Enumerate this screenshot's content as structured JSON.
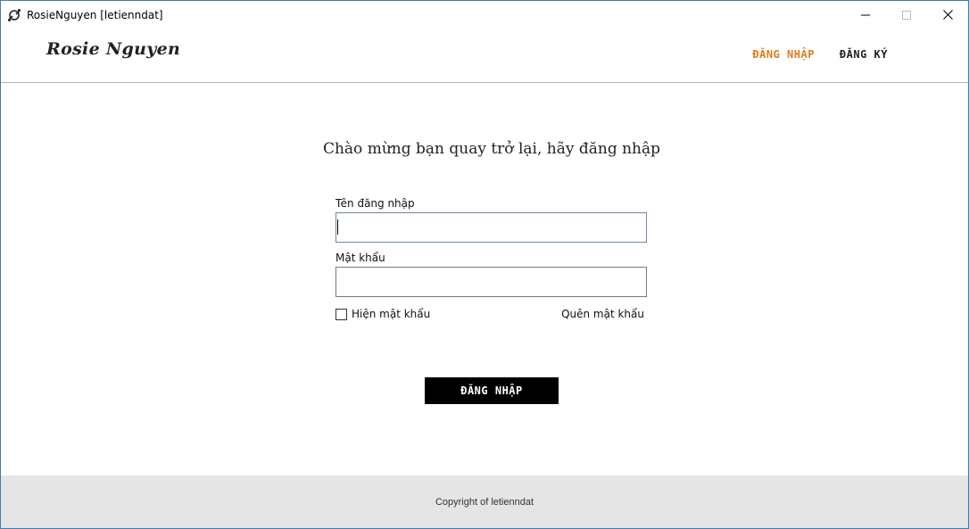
{
  "window": {
    "title": "RosieNguyen [letienndat]"
  },
  "header": {
    "brand": "Rosie Nguyen",
    "nav": {
      "login": "ĐĂNG NHẬP",
      "register": "ĐĂNG KÝ"
    },
    "active_color": "#e07b1a"
  },
  "main": {
    "welcome": "Chào mừng bạn quay trở lại, hãy đăng nhập",
    "username": {
      "label": "Tên đăng nhập",
      "value": ""
    },
    "password": {
      "label": "Mật khẩu",
      "value": ""
    },
    "show_password": {
      "label": "Hiện mật khẩu",
      "checked": false
    },
    "forgot_password": "Quên mật khẩu",
    "submit": "ĐĂNG NHẬP"
  },
  "footer": {
    "copyright": "Copyright of letienndat"
  },
  "icons": {
    "app": "app-logo-icon",
    "minimize": "minimize-icon",
    "maximize": "maximize-icon",
    "close": "close-icon"
  }
}
